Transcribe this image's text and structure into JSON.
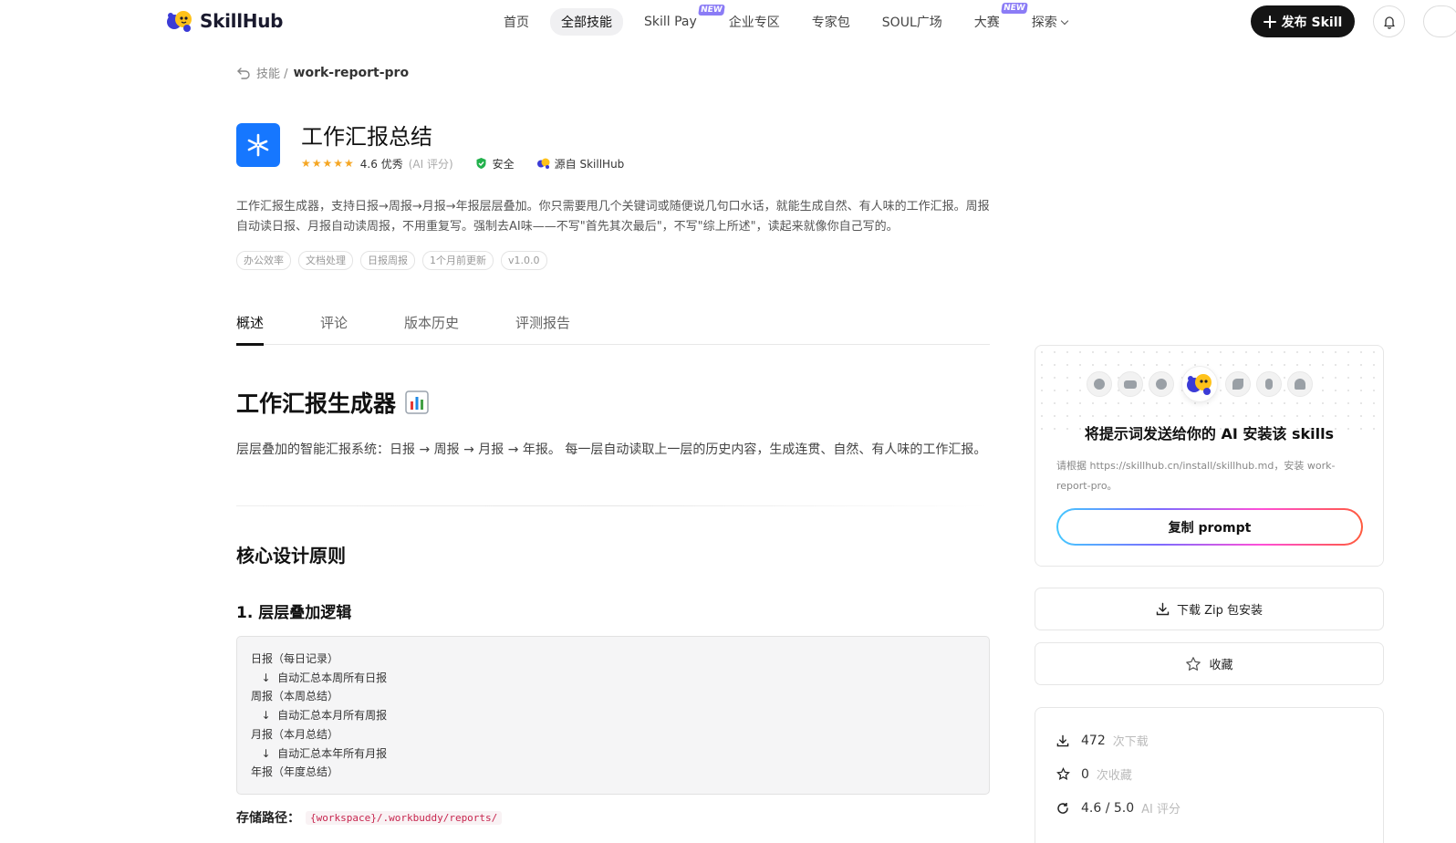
{
  "brand": {
    "name": "SkillHub"
  },
  "nav": {
    "items": [
      {
        "label": "首页",
        "active": false,
        "badge": "",
        "caret": false
      },
      {
        "label": "全部技能",
        "active": true,
        "badge": "",
        "caret": false
      },
      {
        "label": "Skill Pay",
        "active": false,
        "badge": "NEW",
        "caret": false
      },
      {
        "label": "企业专区",
        "active": false,
        "badge": "",
        "caret": false
      },
      {
        "label": "专家包",
        "active": false,
        "badge": "",
        "caret": false
      },
      {
        "label": "SOUL广场",
        "active": false,
        "badge": "",
        "caret": false
      },
      {
        "label": "大赛",
        "active": false,
        "badge": "NEW",
        "caret": false
      },
      {
        "label": "探索",
        "active": false,
        "badge": "",
        "caret": true
      }
    ],
    "publish_label": "发布 Skill"
  },
  "breadcrumb": {
    "parent": "技能 /",
    "current": "work-report-pro"
  },
  "skill": {
    "title": "工作汇报总结",
    "stars": "★★★★★",
    "rating_text": "4.6 优秀",
    "rating_source": "(AI 评分)",
    "safety": "安全",
    "origin": "源自 SkillHub",
    "description": "工作汇报生成器，支持日报→周报→月报→年报层层叠加。你只需要甩几个关键词或随便说几句口水话，就能生成自然、有人味的工作汇报。周报自动读日报、月报自动读周报，不用重复写。强制去AI味——不写\"首先其次最后\"，不写\"综上所述\"，读起来就像你自己写的。",
    "tags": [
      "办公效率",
      "文档处理",
      "日报周报",
      "1个月前更新",
      "v1.0.0"
    ]
  },
  "tabs": [
    "概述",
    "评论",
    "版本历史",
    "评测报告"
  ],
  "content": {
    "h1": "工作汇报生成器",
    "h1_icon": "bar-chart-emoji",
    "intro": "层层叠加的智能汇报系统：日报 → 周报 → 月报 → 年报。 每一层自动读取上一层的历史内容，生成连贯、自然、有人味的工作汇报。",
    "h2": "核心设计原则",
    "h3": "1. 层层叠加逻辑",
    "code_lines": [
      "日报（每日记录）",
      "   ↓  自动汇总本周所有日报",
      "周报（本周总结）",
      "   ↓  自动汇总本月所有周报",
      "月报（本月总结）",
      "   ↓  自动汇总本年所有月报",
      "年报（年度总结）"
    ],
    "storage_label": "存储路径：",
    "storage_path": "{workspace}/.workbuddy/reports/"
  },
  "install": {
    "title": "将提示词发送给你的 AI 安装该 skills",
    "hint": "请根据 https://skillhub.cn/install/skillhub.md，安装 work-report-pro。",
    "copy_label": "复制 prompt",
    "download_label": "下载 Zip 包安装",
    "favorite_label": "收藏"
  },
  "stats": {
    "downloads": "472",
    "downloads_unit": "次下载",
    "favorites": "0",
    "favorites_unit": "次收藏",
    "score": "4.6 / 5.0",
    "score_unit": "AI 评分"
  },
  "colors": {
    "accent": "#1677ff",
    "brand_yellow": "#ffc21a",
    "brand_blue": "#3b3bd6",
    "star": "#f5a623",
    "safe_green": "#22b14c",
    "code_pink": "#c7254e"
  }
}
